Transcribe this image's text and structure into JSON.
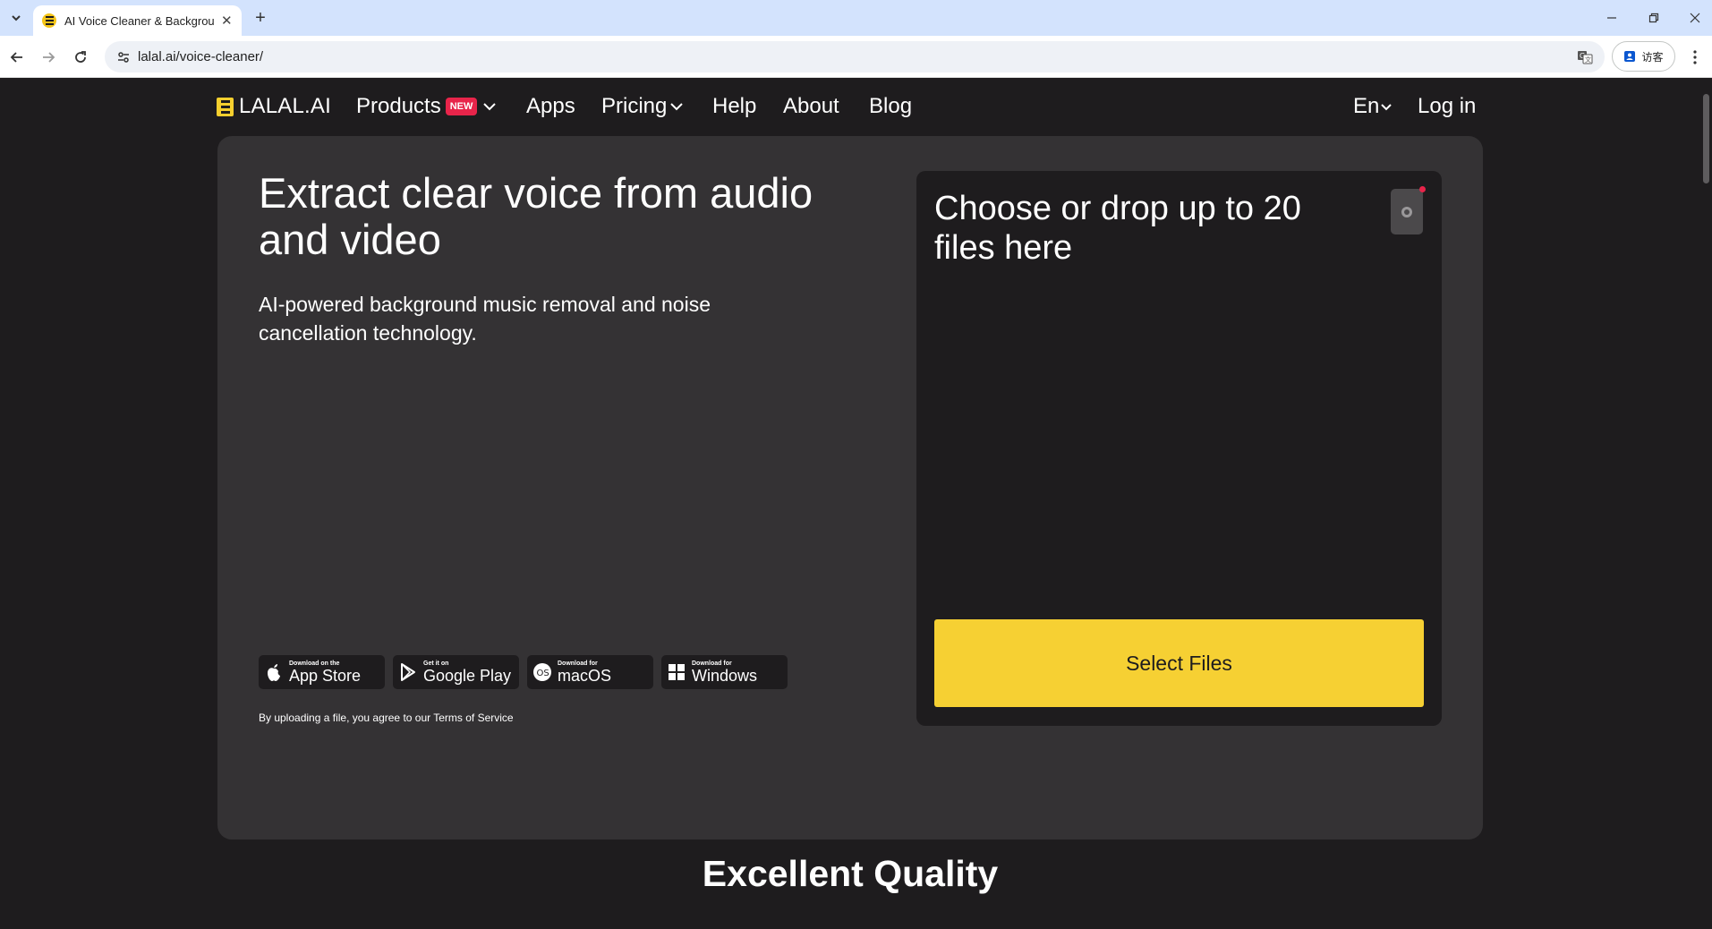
{
  "browser": {
    "tab_title": "AI Voice Cleaner & Background",
    "url": "lalal.ai/voice-cleaner/",
    "profile_label": "访客"
  },
  "site": {
    "logo_text": "LALAL.AI",
    "nav": {
      "products": "Products",
      "new_badge": "NEW",
      "apps": "Apps",
      "pricing": "Pricing",
      "help": "Help",
      "about": "About",
      "blog": "Blog",
      "language": "En",
      "login": "Log in"
    },
    "hero": {
      "title": "Extract clear voice from audio and video",
      "subtitle": "AI-powered background music removal and noise cancellation technology.",
      "stores": [
        {
          "small": "Download on the",
          "big": "App Store",
          "icon": "apple-icon"
        },
        {
          "small": "Get it on",
          "big": "Google Play",
          "icon": "google-play-icon"
        },
        {
          "small": "Download for",
          "big": "macOS",
          "icon": "macos-icon"
        },
        {
          "small": "Download for",
          "big": "Windows",
          "icon": "windows-icon"
        }
      ],
      "terms": "By uploading a file, you agree to our Terms of Service"
    },
    "dropzone": {
      "title": "Choose or drop up to 20 files here",
      "select_button": "Select Files"
    },
    "quality_title": "Excellent Quality"
  },
  "colors": {
    "accent": "#f6d033",
    "background": "#1e1c1e",
    "panel": "#343234",
    "badge": "#e8244a"
  }
}
